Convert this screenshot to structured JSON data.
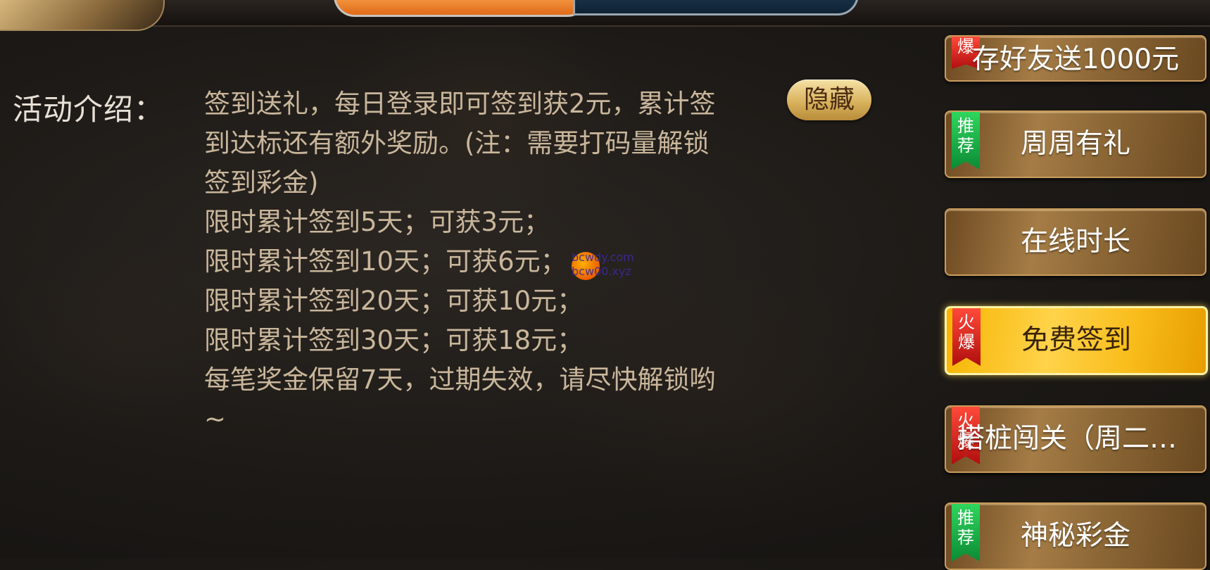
{
  "intro": {
    "label": "活动介绍：",
    "lines": [
      "签到送礼，每日登录即可签到获2元，累计签",
      "到达标还有额外奖励。(注：需要打码量解锁",
      "签到彩金)",
      "限时累计签到5天；可获3元；",
      "限时累计签到10天；可获6元；",
      "限时累计签到20天；可获10元；",
      "限时累计签到30天；可获18元；",
      "每笔奖金保留7天，过期失效，请尽快解锁哟",
      "~"
    ],
    "hide_button": "隐藏"
  },
  "watermark": {
    "line1": "bcwdy.com",
    "line2": "bcw00.xyz"
  },
  "menu": [
    {
      "label": "存好友送1000元",
      "badge": "爆",
      "badge_type": "hot",
      "state": "partial"
    },
    {
      "label": "周周有礼",
      "badge": "推荐",
      "badge_type": "rec",
      "state": "normal"
    },
    {
      "label": "在线时长",
      "badge": "",
      "badge_type": "",
      "state": "normal"
    },
    {
      "label": "免费签到",
      "badge": "火爆",
      "badge_type": "hot",
      "state": "active"
    },
    {
      "label": "搭桩闯关（周二、…",
      "badge": "火爆",
      "badge_type": "hot",
      "state": "normal"
    },
    {
      "label": "神秘彩金",
      "badge": "推荐",
      "badge_type": "rec",
      "state": "normal"
    }
  ],
  "colors": {
    "menu_gold": "#a57c46",
    "menu_active": "#ffd34a",
    "badge_hot": "#c8141a",
    "badge_rec": "#19a944",
    "intro_text": "#c9b69b"
  }
}
